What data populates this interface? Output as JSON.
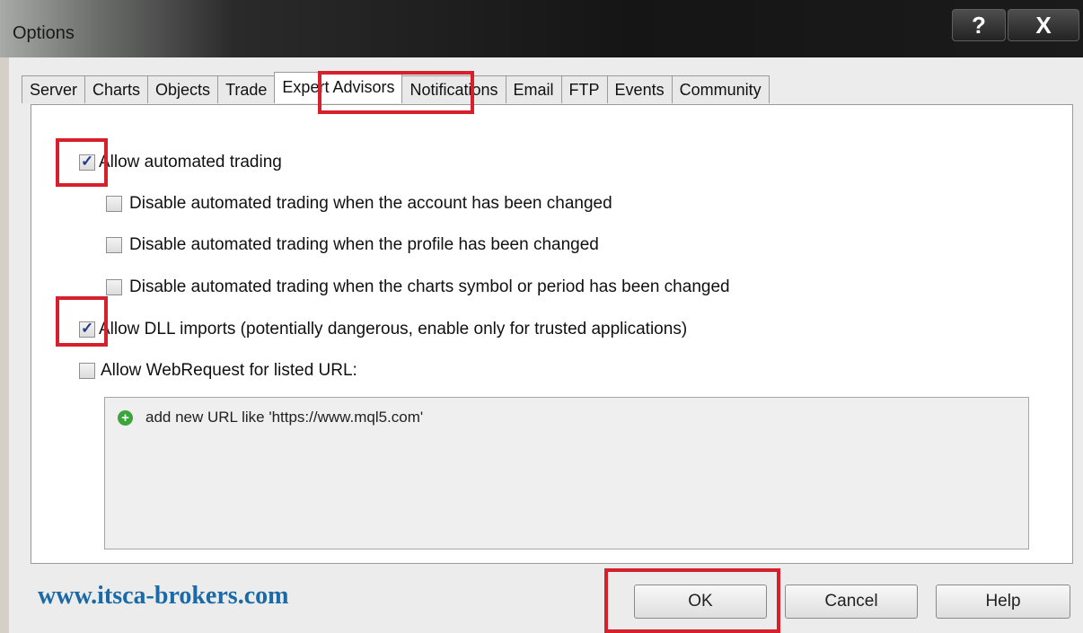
{
  "window": {
    "title": "Options",
    "help_glyph": "?",
    "close_glyph": "X"
  },
  "tabs": [
    {
      "label": "Server"
    },
    {
      "label": "Charts"
    },
    {
      "label": "Objects"
    },
    {
      "label": "Trade"
    },
    {
      "label": "Expert Advisors",
      "active": true
    },
    {
      "label": "Notifications"
    },
    {
      "label": "Email"
    },
    {
      "label": "FTP"
    },
    {
      "label": "Events"
    },
    {
      "label": "Community"
    }
  ],
  "options": {
    "allow_automated": {
      "label": "Allow automated trading",
      "checked": true
    },
    "disable_account": {
      "label": "Disable automated trading when the account has been changed",
      "checked": false
    },
    "disable_profile": {
      "label": "Disable automated trading when the profile has been changed",
      "checked": false
    },
    "disable_symbol": {
      "label": "Disable automated trading when the charts symbol or period has been changed",
      "checked": false
    },
    "allow_dll": {
      "label": "Allow DLL imports (potentially dangerous, enable only for trusted applications)",
      "checked": true
    },
    "allow_webrequest": {
      "label": "Allow WebRequest for listed URL:",
      "checked": false
    }
  },
  "url_list": {
    "add_hint": "add new URL like 'https://www.mql5.com'"
  },
  "footer": {
    "watermark": "www.itsca-brokers.com"
  },
  "buttons": {
    "ok": "OK",
    "cancel": "Cancel",
    "help": "Help"
  },
  "colors": {
    "highlight": "#d6202b",
    "link": "#1a6aa8"
  }
}
